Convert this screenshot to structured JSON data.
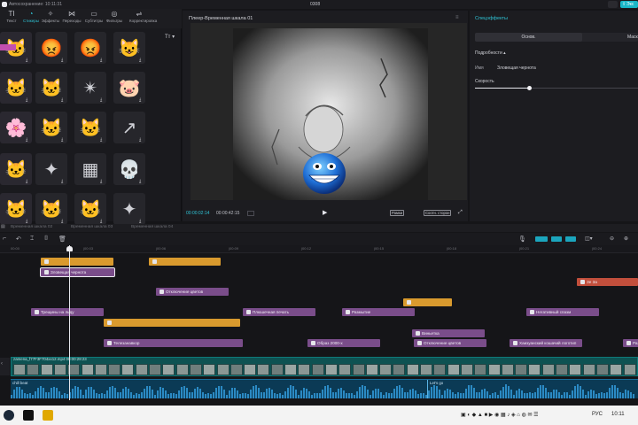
{
  "titlebar": {
    "autosave": "Автосохранение: 10:11:31",
    "project": "0308",
    "export_label": "Экс"
  },
  "toolbar": [
    {
      "icon": "text-icon",
      "glyph": "TI",
      "label": "Текст"
    },
    {
      "icon": "sticker-icon",
      "glyph": "◔",
      "label": "Стикеры"
    },
    {
      "icon": "effects-icon",
      "glyph": "✧",
      "label": "Эффекты"
    },
    {
      "icon": "transitions-icon",
      "glyph": "⋈",
      "label": "Переходы"
    },
    {
      "icon": "subtitles-icon",
      "glyph": "▭",
      "label": "Субтитры"
    },
    {
      "icon": "filters-icon",
      "glyph": "◎",
      "label": "Фильтры"
    },
    {
      "icon": "adjust-icon",
      "glyph": "⇌",
      "label": "Корректировка"
    }
  ],
  "stickers": [
    "🐱",
    "😡",
    "😡",
    "😺",
    "🐱",
    "🐱",
    "✴",
    "🐷",
    "🌸",
    "🐱",
    "🐱",
    "↗",
    "🐱",
    "✦",
    "▦",
    "💀",
    "🐱",
    "🐱",
    "🐱",
    "✦"
  ],
  "player": {
    "title": "Плеер-Временная шкала 01",
    "time_current": "00:00:02:14",
    "time_total": "00:00:42:15",
    "btn_orig": "Рамки",
    "btn_ratio": "Соотн. сторон"
  },
  "specs": {
    "title": "Спецэффекты",
    "tab_basic": "Основ.",
    "tab_mask": "Маск",
    "details": "Подробности",
    "name_label": "Имя",
    "name_value": "Зловещая чернота",
    "speed_label": "Скорость",
    "speed_value": 0.33
  },
  "timeline": {
    "tabs": [
      "Временная шкала 02",
      "Временная шкала 03",
      "Временная шкала 04"
    ],
    "ruler": [
      "00:00",
      "|00:03",
      "|00:06",
      "|00:09",
      "|00:12",
      "|00:15",
      "|00:18",
      "|00:21",
      "|00:24"
    ],
    "clips": [
      {
        "label": "",
        "type": "o",
        "row": 0
      },
      {
        "label": "",
        "type": "o",
        "row": 0
      },
      {
        "label": "Зловещая чернота",
        "type": "p",
        "row": 1,
        "selected": true
      },
      {
        "label": "Зе За",
        "type": "r",
        "row": 2
      },
      {
        "label": "Отключение цветов",
        "type": "p",
        "row": 3
      },
      {
        "label": "",
        "type": "o",
        "row": 4
      },
      {
        "label": "Трещины на льду",
        "type": "p",
        "row": 5
      },
      {
        "label": "Плюшечная печать",
        "type": "p",
        "row": 5
      },
      {
        "label": "Размытие",
        "type": "p",
        "row": 5
      },
      {
        "label": "Негативный спазм",
        "type": "p",
        "row": 5
      },
      {
        "label": "",
        "type": "o",
        "row": 6
      },
      {
        "label": "Виньетка",
        "type": "p",
        "row": 7
      },
      {
        "label": "Телезанавкор",
        "type": "p",
        "row": 8
      },
      {
        "label": "Образ 2000-х",
        "type": "p",
        "row": 8
      },
      {
        "label": "Отключение цветов",
        "type": "p",
        "row": 8
      },
      {
        "label": "Хаизуанский кошачий логотип",
        "type": "p",
        "row": 8
      },
      {
        "label": "Разд",
        "type": "p",
        "row": 8
      }
    ],
    "main_video": "zamena_f77F3F704xx12.mp4  00:00:28:23",
    "audio1": "chill beat",
    "audio2": "Let's go"
  },
  "taskbar": {
    "time": "10:11",
    "date": "",
    "lang": "РУС"
  }
}
